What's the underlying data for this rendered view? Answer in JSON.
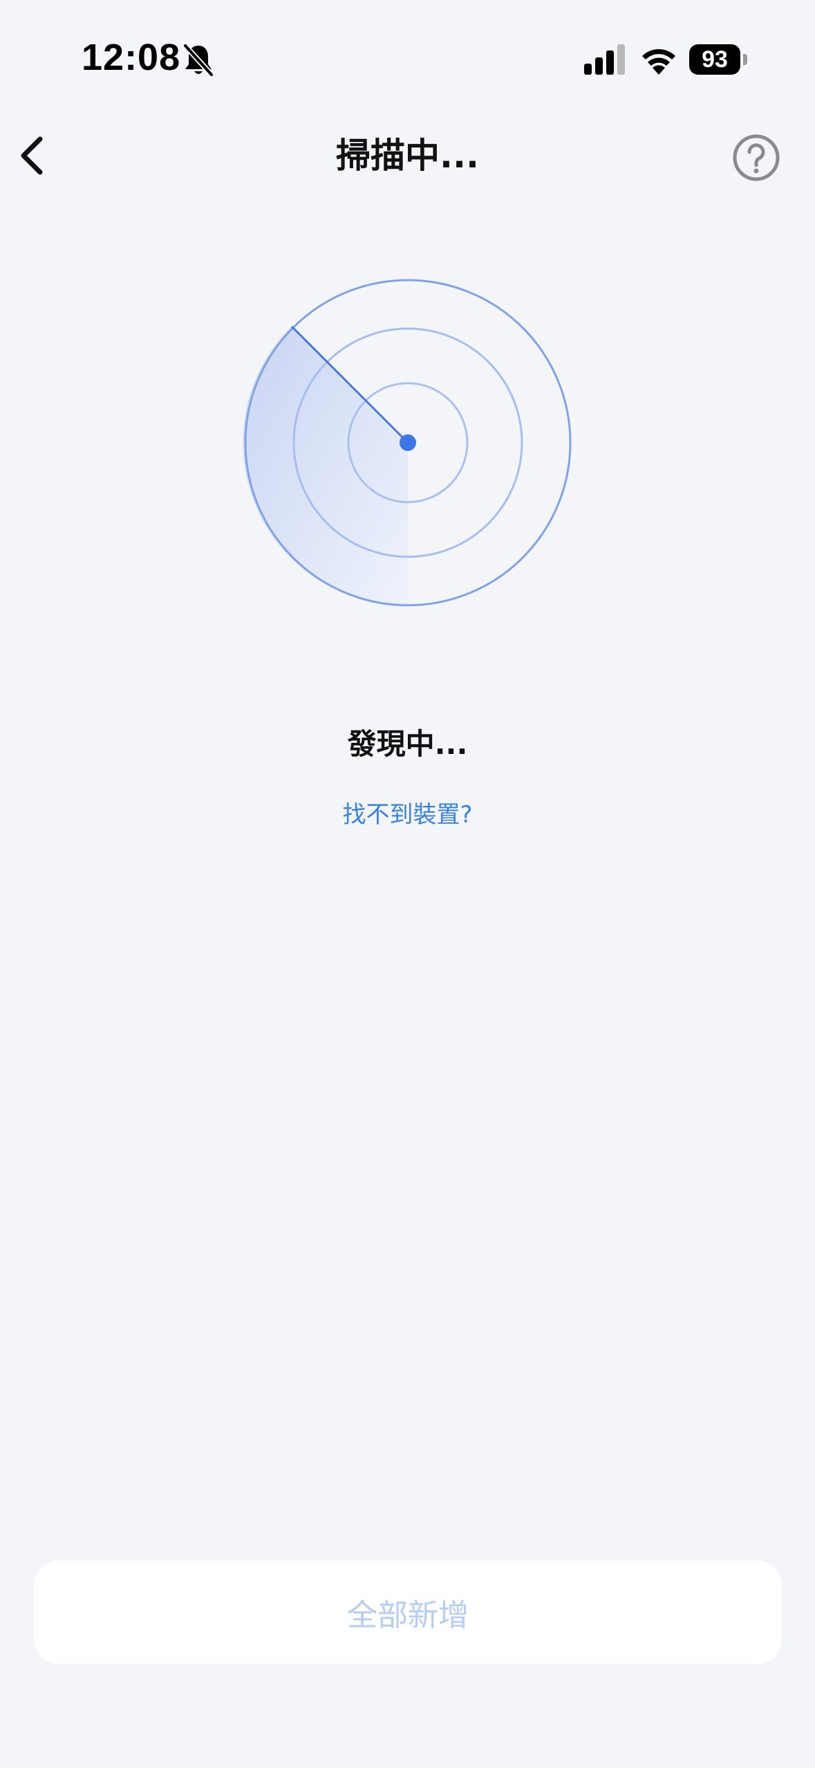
{
  "status_bar": {
    "time": "12:08",
    "battery": "93",
    "silent_icon": "bell-slash-icon",
    "signal_icon": "cellular-signal-icon",
    "wifi_icon": "wifi-icon"
  },
  "header": {
    "title": "掃描中...",
    "back_icon": "chevron-left-icon",
    "help_icon": "question-circle-icon"
  },
  "scanner": {
    "radar_icon": "radar-scan-icon",
    "status": "發現中...",
    "help_link": "找不到裝置?"
  },
  "footer": {
    "add_all_label": "全部新增"
  },
  "colors": {
    "background": "#f3f5f8",
    "accent": "#3a82df",
    "radar": "#7fa3e6",
    "disabled_button_text": "#b5cdf1"
  }
}
